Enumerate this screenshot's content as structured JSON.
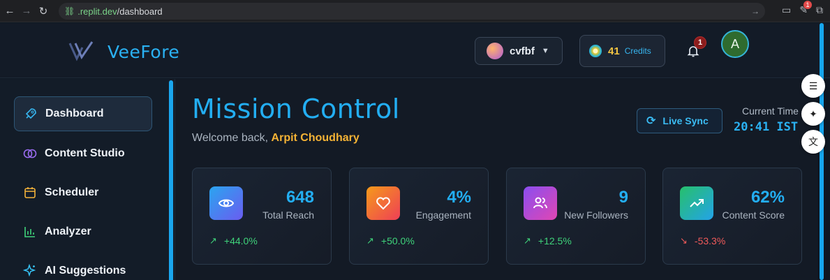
{
  "browser": {
    "url_host": ".replit.dev",
    "url_path": "/dashboard",
    "extension_badge": "1"
  },
  "header": {
    "brand": "VeeFore",
    "workspace_name": "cvfbf",
    "credits_value": "41",
    "credits_label": "Credits",
    "notifications_count": "1",
    "avatar_initial": "A"
  },
  "sidebar": {
    "items": [
      {
        "label": "Dashboard",
        "icon": "rocket-icon",
        "active": true
      },
      {
        "label": "Content Studio",
        "icon": "brain-icon",
        "active": false
      },
      {
        "label": "Scheduler",
        "icon": "calendar-icon",
        "active": false
      },
      {
        "label": "Analyzer",
        "icon": "bar-chart-icon",
        "active": false
      },
      {
        "label": "AI Suggestions",
        "icon": "sparkles-icon",
        "active": false
      }
    ]
  },
  "main": {
    "title": "Mission Control",
    "welcome_prefix": "Welcome back,",
    "user_name": "Arpit Choudhary",
    "live_sync_label": "Live Sync",
    "current_time_label": "Current Time",
    "current_time_value": "20:41 IST"
  },
  "cards": [
    {
      "value": "648",
      "label": "Total Reach",
      "trend": "+44.0%",
      "direction": "up",
      "icon": "eye-icon",
      "gradient": [
        "#2aa5f0",
        "#6a5cf0"
      ]
    },
    {
      "value": "4%",
      "label": "Engagement",
      "trend": "+50.0%",
      "direction": "up",
      "icon": "heart-icon",
      "gradient": [
        "#f59a1a",
        "#ef3f56"
      ]
    },
    {
      "value": "9",
      "label": "New Followers",
      "trend": "+12.5%",
      "direction": "up",
      "icon": "users-icon",
      "gradient": [
        "#8a4ef0",
        "#e046b3"
      ]
    },
    {
      "value": "62%",
      "label": "Content Score",
      "trend": "-53.3%",
      "direction": "down",
      "icon": "trending-up-icon",
      "gradient": [
        "#27c06b",
        "#23a3e8"
      ]
    }
  ]
}
